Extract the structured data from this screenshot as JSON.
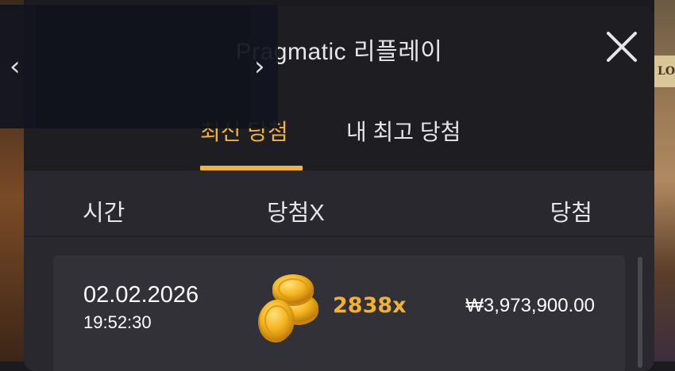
{
  "dialog": {
    "title": "Pragmatic 리플레이"
  },
  "tabs": [
    {
      "label": "최신 당첨",
      "active": true
    },
    {
      "label": "내 최고 당첨",
      "active": false
    }
  ],
  "columns": {
    "time": "시간",
    "multiplier": "당첨X",
    "win": "당첨"
  },
  "rows": [
    {
      "date": "02.02.2026",
      "time": "19:52:30",
      "multiplier": "2838x",
      "win": "₩3,973,900.00",
      "icon": "gold-coins-icon"
    }
  ],
  "background_sign": "LOO",
  "colors": {
    "accent": "#f0b23a",
    "dialog_bg": "#29282e",
    "header_bg": "#1e1d22",
    "row_bg": "#323137"
  },
  "icons": {
    "close": "close-icon",
    "prev": "chevron-left-icon",
    "next": "chevron-right-icon"
  }
}
